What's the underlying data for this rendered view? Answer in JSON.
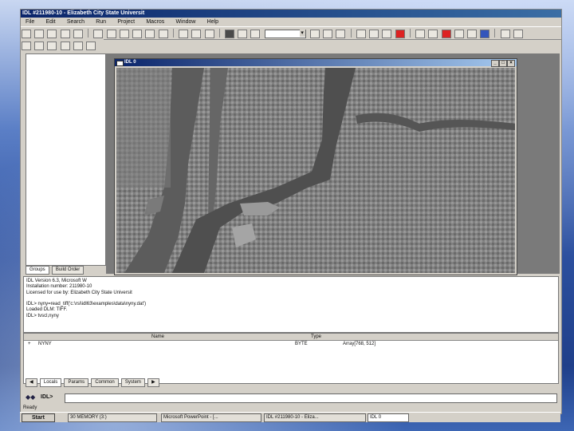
{
  "app": {
    "title": "IDL #211980-10 - Elizabeth City State Universit",
    "menu": [
      "File",
      "Edit",
      "Search",
      "Run",
      "Project",
      "Macros",
      "Window",
      "Help"
    ]
  },
  "left_panel": {
    "tabs": [
      "Groups",
      "Build Order"
    ]
  },
  "image_window": {
    "title": "IDL 0"
  },
  "console": {
    "lines": [
      "IDL Version 6.3, Microsoft W",
      "Installation number: 211980-10",
      "Licensed for use by: Elizabeth City State Universit",
      "",
      "IDL> nyny=read_tiff('c:\\rsi\\idl63\\examples\\data\\nyny.dat')",
      "Loaded DLM: TIFF.",
      "IDL> tvscl,nyny"
    ]
  },
  "variables": {
    "columns": [
      "Name",
      "Type"
    ],
    "rows": [
      {
        "name": "NYNY",
        "type": "BYTE",
        "value": "Array[768, 512]"
      }
    ],
    "tabs": [
      "Locals",
      "Params",
      "Common",
      "System"
    ]
  },
  "command_line": {
    "label": "IDL>",
    "value": ""
  },
  "status": {
    "text": "Ready"
  },
  "taskbar": {
    "start_label": "Start",
    "items": [
      "30 MEMORY (3:)",
      "Microsoft PowerPoint - [...",
      "IDL #211980-10 - Eliza...",
      "IDL 0"
    ]
  },
  "colors": {
    "title_blue": "#0a246a",
    "chrome": "#d4d0c8"
  }
}
